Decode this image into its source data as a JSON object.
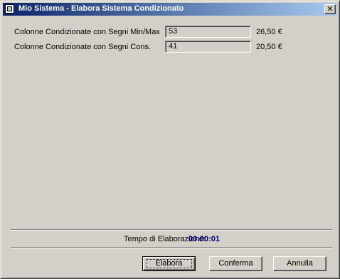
{
  "window": {
    "title": "Mio Sistema - Elabora Sistema Condizionato",
    "close_glyph": "✕"
  },
  "rows": [
    {
      "label": "Colonne Condizionate con Segni Min/Max",
      "value": "53",
      "price": "26,50 €"
    },
    {
      "label": "Colonne Condizionate con Segni Cons.",
      "value": "41",
      "price": "20,50 €"
    }
  ],
  "footer": {
    "time_label": "Tempo di Elaborazione:",
    "time_value": "00:00:01"
  },
  "buttons": {
    "elabora": "Elabora",
    "conferma": "Conferma",
    "annulla": "Annulla"
  },
  "colors": {
    "titlebar_start": "#0a246a",
    "titlebar_end": "#a6caf0",
    "time_value": "#000080",
    "face": "#d4d0c8"
  }
}
